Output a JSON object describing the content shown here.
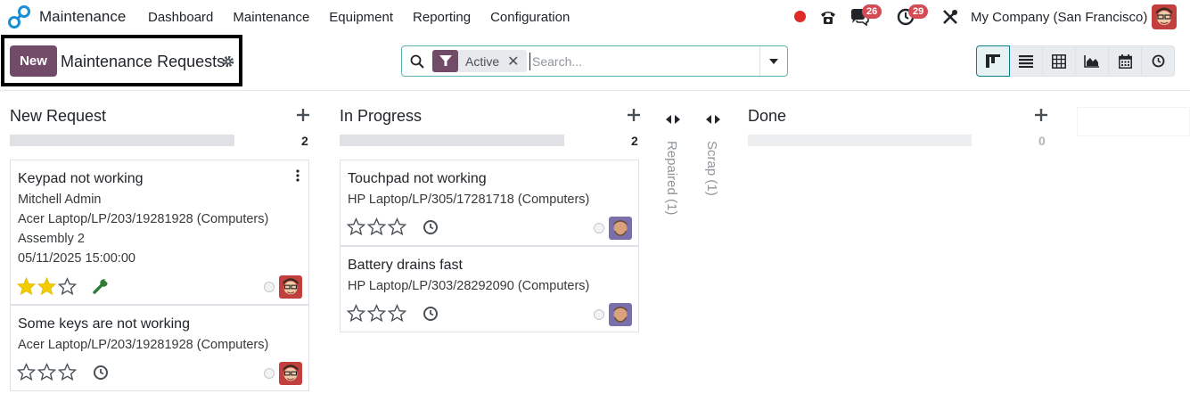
{
  "navbar": {
    "app_name": "Maintenance",
    "menu": [
      "Dashboard",
      "Maintenance",
      "Equipment",
      "Reporting",
      "Configuration"
    ],
    "messages_badge": "26",
    "activities_badge": "29",
    "company": "My Company (San Francisco)"
  },
  "control": {
    "new_label": "New",
    "title": "Maintenance Requests",
    "filter_facet": "Active",
    "search_placeholder": "Search...",
    "views": [
      "kanban",
      "list",
      "pivot",
      "graph",
      "calendar",
      "activity"
    ],
    "active_view": "kanban"
  },
  "colors": {
    "brand": "#714b67",
    "accent": "#0d7f86",
    "badge": "#d44b55",
    "star_filled": "#f3cc00",
    "wrench": "#2e7d32"
  },
  "columns": [
    {
      "name": "New Request",
      "count": "2",
      "cards": [
        {
          "title": "Keypad not working",
          "lines": [
            "Mitchell Admin",
            "Acer Laptop/LP/203/19281928 (Computers)",
            "Assembly 2",
            "05/11/2025 15:00:00"
          ],
          "stars": 2,
          "icon": "wrench-icon"
        },
        {
          "title": "Some keys are not working",
          "lines": [
            "Acer Laptop/LP/203/19281928 (Computers)"
          ],
          "stars": 0,
          "icon": "clock-icon"
        }
      ]
    },
    {
      "name": "In Progress",
      "count": "2",
      "cards": [
        {
          "title": "Touchpad not working",
          "lines": [
            "HP Laptop/LP/305/17281718 (Computers)"
          ],
          "stars": 0,
          "icon": "clock-icon"
        },
        {
          "title": "Battery drains fast",
          "lines": [
            "HP Laptop/LP/303/28292090 (Computers)"
          ],
          "stars": 0,
          "icon": "clock-icon"
        }
      ]
    },
    {
      "name": "Done",
      "count": "0",
      "cards": []
    }
  ],
  "folded_columns": [
    "Repaired (1)",
    "Scrap (1)"
  ]
}
